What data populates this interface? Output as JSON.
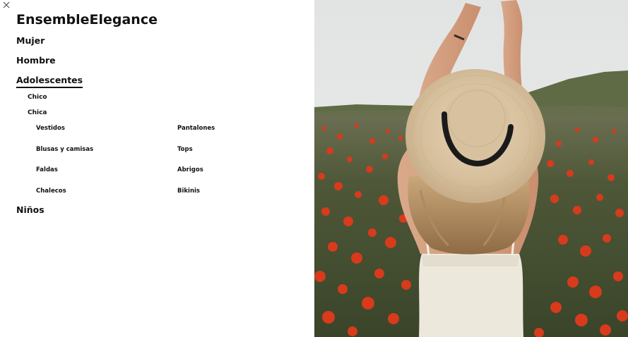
{
  "brand": {
    "name": "EnsembleElegance"
  },
  "close": {
    "icon": "close-icon"
  },
  "nav": {
    "mujer": "Mujer",
    "hombre": "Hombre",
    "adolescentes": "Adolescentes",
    "chico": "Chico",
    "chica": "Chica",
    "chica_items": {
      "vestidos": "Vestidos",
      "pantalones": "Pantalones",
      "blusas": "Blusas y camisas",
      "tops": "Tops",
      "faldas": "Faldas",
      "abrigos": "Abrigos",
      "chalecos": "Chalecos",
      "bikinis": "Bikinis"
    },
    "ninos": "Niños"
  },
  "colors": {
    "accent": "#111111",
    "background": "#ffffff",
    "poppy_red": "#d83a1c",
    "hat_straw": "#d9c3a3",
    "hat_band": "#1a1a1a",
    "sky": "#e7e9e8",
    "field_green": "#4f5a3a"
  }
}
